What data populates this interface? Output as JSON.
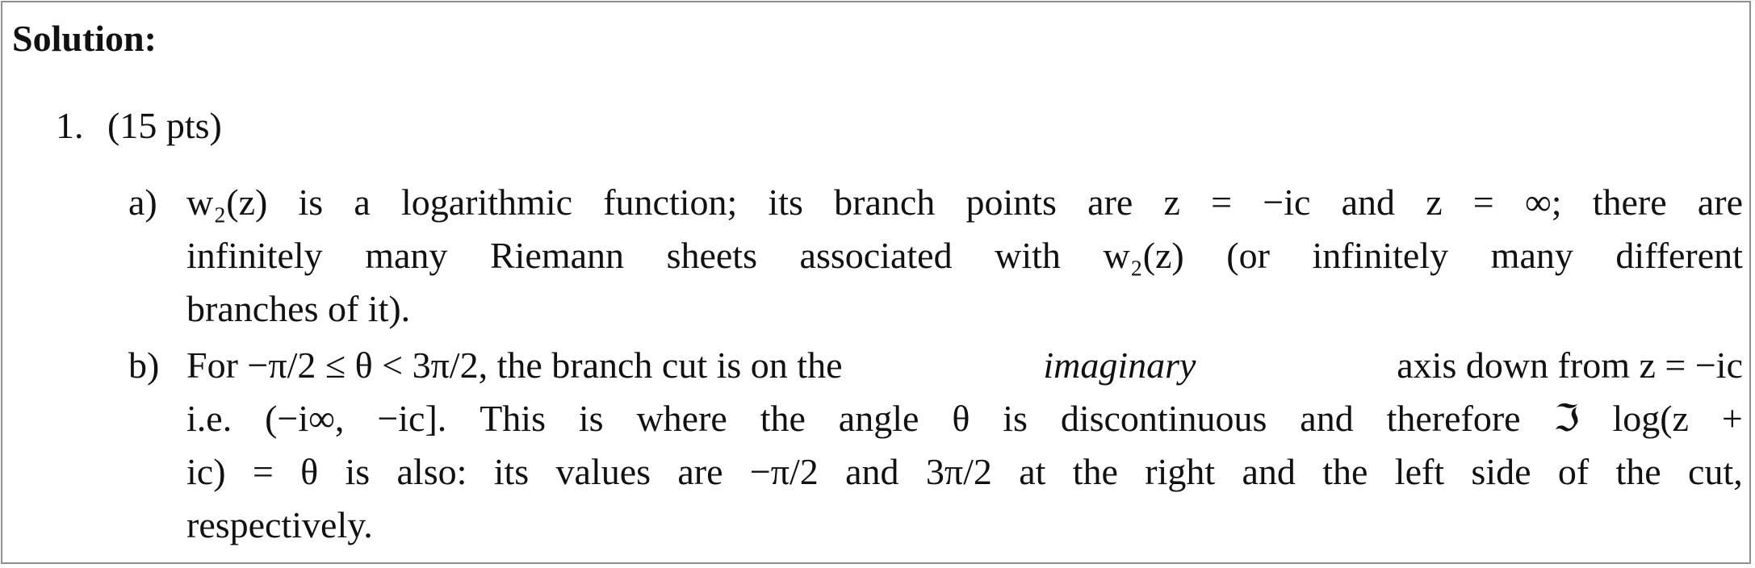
{
  "heading": "Solution:",
  "item": {
    "number": "1.",
    "points": "(15 pts)"
  },
  "part_a": {
    "marker": "a)",
    "lines": [
      "w₂(z) is a logarithmic function; its branch points are z = −ic and z = ∞; there are",
      "infinitely many Riemann sheets associated with w₂(z) (or infinitely many different",
      "branches of it)."
    ]
  },
  "part_b": {
    "marker": "b)",
    "line1_pre": "For −π/2 ≤ θ < 3π/2, the branch cut is on the",
    "line1_em": "imaginary",
    "line1_post": "axis down from z = −ic",
    "line2": "i.e. (−i∞, −ic]. This is where the angle θ is discontinuous and therefore ℑ log(z +",
    "line3": "ic) = θ is also: its values are −π/2 and 3π/2 at the right and the left side of the cut,",
    "line4": "respectively."
  }
}
